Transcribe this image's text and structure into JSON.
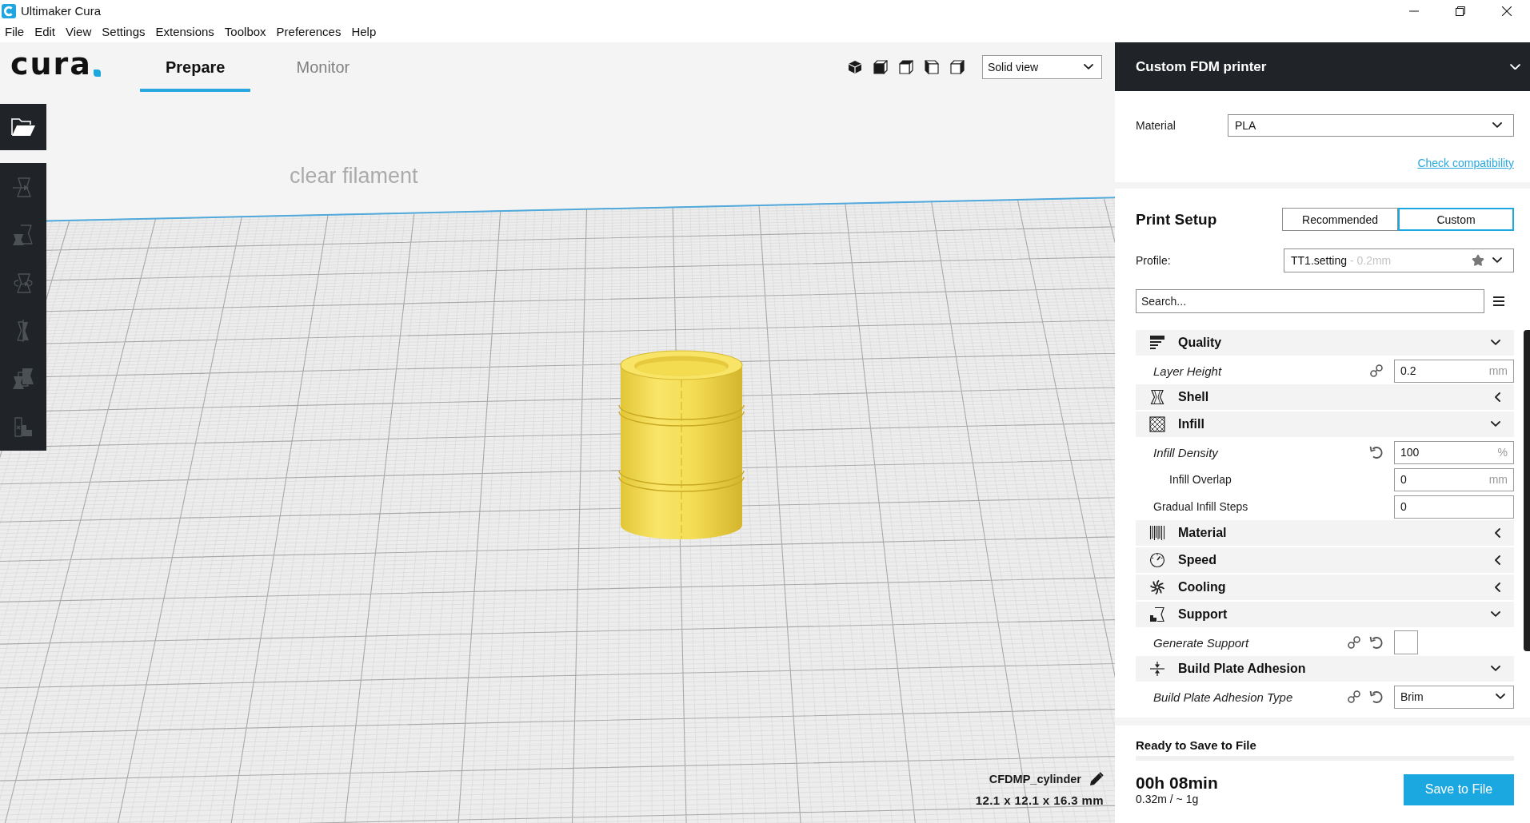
{
  "window": {
    "title": "Ultimaker Cura"
  },
  "menu": [
    "File",
    "Edit",
    "View",
    "Settings",
    "Extensions",
    "Toolbox",
    "Preferences",
    "Help"
  ],
  "header": {
    "logo": "cura",
    "tabs": [
      {
        "label": "Prepare",
        "selected": true
      },
      {
        "label": "Monitor",
        "selected": false
      }
    ],
    "view_mode": "Solid view"
  },
  "toolbar": {
    "tools": [
      {
        "disabled": true
      },
      {
        "disabled": true
      },
      {
        "disabled": true
      },
      {
        "disabled": true
      },
      {
        "disabled": true
      },
      {
        "disabled": true
      }
    ]
  },
  "viewport": {
    "filament_label": "clear filament",
    "object": {
      "name": "CFDMP_cylinder",
      "dimensions": "12.1 x 12.1 x 16.3 mm"
    }
  },
  "printer_panel": {
    "printer": "Custom FDM printer",
    "material_label": "Material",
    "material": "PLA",
    "compatibility_link": "Check compatibility"
  },
  "print_setup": {
    "title": "Print Setup",
    "modes": [
      {
        "label": "Recommended",
        "selected": false
      },
      {
        "label": "Custom",
        "selected": true
      }
    ],
    "profile_label": "Profile:",
    "profile": {
      "name": "TT1.setting",
      "detail": "- 0.2mm"
    },
    "search": {
      "placeholder": "Search..."
    },
    "categories": [
      {
        "label": "Quality",
        "expanded": true,
        "settings": [
          {
            "kind": "number",
            "label": "Layer Height",
            "modified": true,
            "linked": true,
            "resettable": false,
            "value": "0.2",
            "unit": "mm"
          }
        ]
      },
      {
        "label": "Shell",
        "expanded": false
      },
      {
        "label": "Infill",
        "expanded": true,
        "settings": [
          {
            "kind": "number",
            "label": "Infill Density",
            "modified": true,
            "linked": false,
            "resettable": true,
            "value": "100",
            "unit": "%",
            "children": [
              {
                "kind": "number",
                "label": "Infill Overlap",
                "modified": false,
                "linked": false,
                "resettable": false,
                "value": "0",
                "unit": "mm"
              }
            ]
          },
          {
            "kind": "number",
            "label": "Gradual Infill Steps",
            "modified": false,
            "linked": false,
            "resettable": false,
            "value": "0"
          }
        ]
      },
      {
        "label": "Material",
        "expanded": false
      },
      {
        "label": "Speed",
        "expanded": false
      },
      {
        "label": "Cooling",
        "expanded": false
      },
      {
        "label": "Support",
        "expanded": true,
        "settings": [
          {
            "kind": "checkbox",
            "label": "Generate Support",
            "modified": true,
            "linked": true,
            "resettable": true,
            "checked": false
          }
        ]
      },
      {
        "label": "Build Plate Adhesion",
        "expanded": true,
        "settings": [
          {
            "kind": "dropdown",
            "label": "Build Plate Adhesion Type",
            "modified": true,
            "linked": true,
            "resettable": true,
            "value": "Brim"
          }
        ]
      }
    ]
  },
  "output": {
    "status": "Ready to Save to File",
    "time": "00h 08min",
    "usage": "0.32m / ~ 1g",
    "button": "Save to File"
  }
}
